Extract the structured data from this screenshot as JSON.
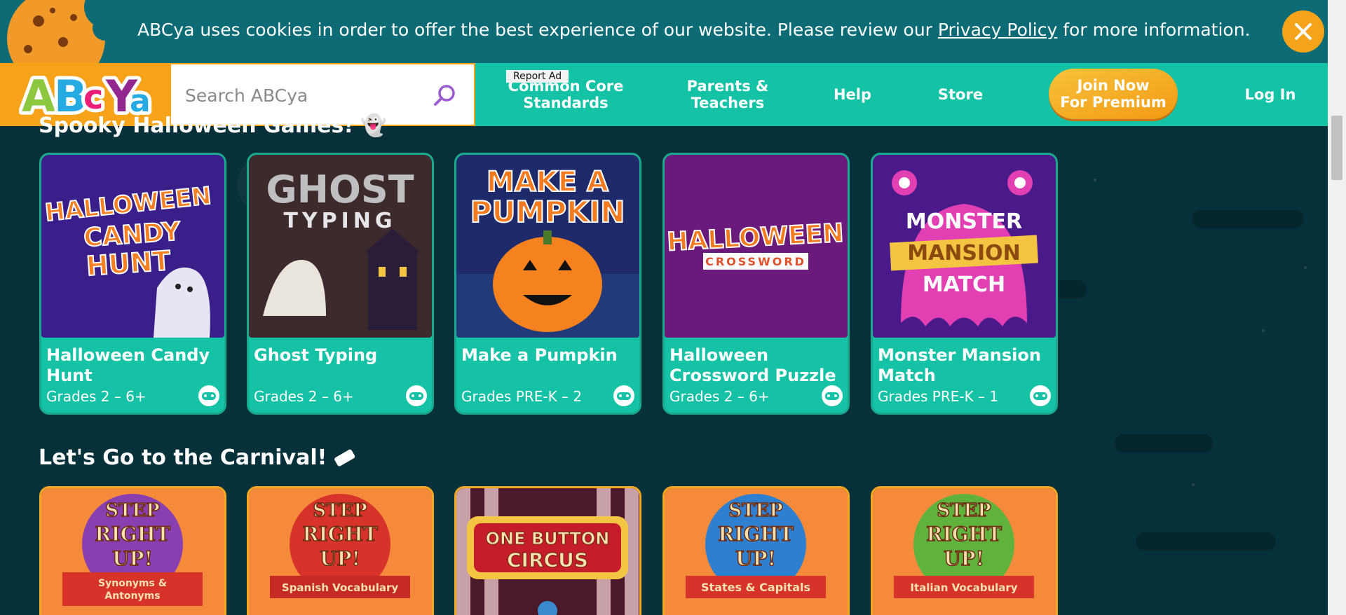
{
  "cookie_banner": {
    "text_before": "ABCya uses cookies in order to offer the best experience of our website. Please review our ",
    "link_text": "Privacy Policy",
    "text_after": " for more information.",
    "close_icon": "close-icon"
  },
  "header": {
    "logo_text": "ABCya",
    "search_placeholder": "Search ABCya",
    "report_ad": "Report Ad",
    "nav": {
      "common_core_line1": "Common Core",
      "common_core_line2": "Standards",
      "parents_line1": "Parents &",
      "parents_line2": "Teachers",
      "help": "Help",
      "store": "Store",
      "join_line1": "Join Now",
      "join_line2": "For Premium",
      "login": "Log In"
    }
  },
  "sections": {
    "halloween": {
      "title": "Spooky Halloween Games!",
      "games": [
        {
          "title": "Halloween Candy Hunt",
          "grades": "Grades 2 – 6+",
          "thumb_lines": [
            "HALLOWEEN",
            "CANDY",
            "HUNT"
          ]
        },
        {
          "title": "Ghost Typing",
          "grades": "Grades 2 – 6+",
          "thumb_lines": [
            "GHOST",
            "TYPING"
          ]
        },
        {
          "title": "Make a Pumpkin",
          "grades": "Grades PRE-K – 2",
          "thumb_lines": [
            "MAKE A",
            "PUMPKIN"
          ]
        },
        {
          "title": "Halloween Crossword Puzzle",
          "grades": "Grades 2 – 6+",
          "thumb_lines": [
            "HALLOWEEN",
            "CROSSWORD"
          ]
        },
        {
          "title": "Monster Mansion Match",
          "grades": "Grades PRE-K – 1",
          "thumb_lines": [
            "MONSTER",
            "MANSION",
            "MATCH"
          ]
        }
      ]
    },
    "carnival": {
      "title": "Let's Go to the Carnival!",
      "games": [
        {
          "thumb_lines": [
            "STEP",
            "RIGHT",
            "UP!",
            "Synonyms &",
            "Antonyms"
          ],
          "color": "#8a3fb0"
        },
        {
          "thumb_lines": [
            "STEP",
            "RIGHT",
            "UP!",
            "Spanish Vocabulary"
          ],
          "color": "#d8332a"
        },
        {
          "thumb_lines": [
            "ONE BUTTON",
            "CIRCUS"
          ],
          "color": "#c61d2a"
        },
        {
          "thumb_lines": [
            "STEP",
            "RIGHT",
            "UP!",
            "States & Capitals"
          ],
          "color": "#2f7fd1"
        },
        {
          "thumb_lines": [
            "STEP",
            "RIGHT",
            "UP!",
            "Italian Vocabulary"
          ],
          "color": "#5fb33c"
        }
      ]
    }
  },
  "colors": {
    "banner": "#0c6b74",
    "header": "#14c2a6",
    "accent": "#f6a319",
    "page_bg": "#06303a"
  }
}
